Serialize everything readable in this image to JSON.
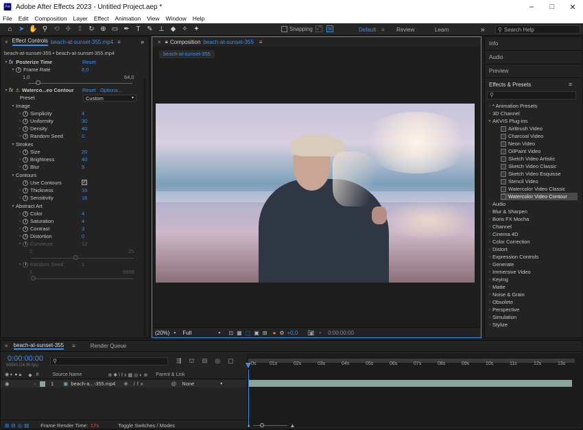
{
  "app": {
    "title": "Adobe After Effects 2023 - Untitled Project.aep *",
    "logo": "Ae"
  },
  "menu": [
    "File",
    "Edit",
    "Composition",
    "Layer",
    "Effect",
    "Animation",
    "View",
    "Window",
    "Help"
  ],
  "window_controls": {
    "minimize": "–",
    "maximize": "□",
    "close": "✕"
  },
  "toolbar": {
    "snapping_label": "Snapping",
    "workspaces": [
      "Default",
      "Review",
      "Learn"
    ],
    "search_placeholder": "Search Help",
    "more": "»"
  },
  "effect_controls": {
    "tab_label": "Effect Controls",
    "tab_file": "beach-at-sunset-355.mp4",
    "breadcrumb": "beach-at-sunset-355 • beach-at-sunset-355.mp4",
    "posterize": {
      "name": "Posterize Time",
      "reset": "Reset",
      "frame_rate_label": "Frame Rate",
      "frame_rate": "8,0",
      "range_min": "1,0",
      "range_max": "64,0"
    },
    "watercolor": {
      "name": "Waterco...eo Contour",
      "reset": "Reset",
      "options": "Options...",
      "preset_label": "Preset",
      "preset_value": "Custom",
      "groups": [
        {
          "name": "Image",
          "params": [
            {
              "label": "Simplicity",
              "value": "4"
            },
            {
              "label": "Uniformity",
              "value": "30"
            },
            {
              "label": "Density",
              "value": "40"
            },
            {
              "label": "Random Seed",
              "value": "0"
            }
          ]
        },
        {
          "name": "Strokes",
          "params": [
            {
              "label": "Size",
              "value": "20"
            },
            {
              "label": "Brightness",
              "value": "40"
            },
            {
              "label": "Blur",
              "value": "5"
            }
          ]
        },
        {
          "name": "Contours",
          "params": [
            {
              "label": "Use Contours",
              "value": "checked"
            },
            {
              "label": "Thickness",
              "value": "16"
            },
            {
              "label": "Sensitivity",
              "value": "16"
            }
          ]
        },
        {
          "name": "Abstract Art",
          "params": [
            {
              "label": "Color",
              "value": "4"
            },
            {
              "label": "Saturation",
              "value": "4"
            },
            {
              "label": "Contrast",
              "value": "3"
            },
            {
              "label": "Distortion",
              "value": "0"
            }
          ]
        }
      ],
      "curvature": {
        "label": "Curvature",
        "value": "12",
        "min": "2",
        "max": "25"
      },
      "random_seed2": {
        "label": "Random Seed",
        "value": "1",
        "min": "1",
        "max": "9999"
      }
    }
  },
  "composition": {
    "tab_label": "Composition",
    "tab_name": "beach-at-sunset-355",
    "subtab": "beach-at-sunset-355",
    "zoom": "(20%)",
    "resolution": "Full",
    "exposure": "+0,0",
    "timecode": "0:00:00:00"
  },
  "right_panels": {
    "info": "Info",
    "audio": "Audio",
    "preview": "Preview",
    "effects_presets": "Effects & Presets",
    "categories_top": [
      "* Animation Presets",
      "3D Channel"
    ],
    "akvis": {
      "name": "AKVIS Plug-ins",
      "items": [
        "AirBrush Video",
        "Charcoal Video",
        "Neon Video",
        "OilPaint Video",
        "Sketch Video Artistic",
        "Sketch Video Classic",
        "Sketch Video Esquisse",
        "Stencil Video",
        "Watercolor Video Classic",
        "Watercolor Video Contour"
      ],
      "selected": "Watercolor Video Contour"
    },
    "categories": [
      "Audio",
      "Blur & Sharpen",
      "Boris FX Mocha",
      "Channel",
      "Cinema 4D",
      "Color Correction",
      "Distort",
      "Expression Controls",
      "Generate",
      "Immersive Video",
      "Keying",
      "Matte",
      "Noise & Grain",
      "Obsolete",
      "Perspective",
      "Simulation",
      "Stylize"
    ]
  },
  "timeline": {
    "tab_label": "beach-at-sunset-355",
    "render_queue": "Render Queue",
    "timecode": "0:00:00:00",
    "fps": "00000 (24.00 fps)",
    "columns": {
      "num": "#",
      "source": "Source Name",
      "parent": "Parent & Link"
    },
    "layer": {
      "num": "1",
      "name": "beach-a...-355.mp4",
      "parent": "None"
    },
    "ruler": [
      "0s",
      "01s",
      "02s",
      "03s",
      "04s",
      "05s",
      "06s",
      "07s",
      "08s",
      "09s",
      "10s",
      "11s",
      "12s",
      "13s"
    ],
    "footer": {
      "render_label": "Frame Render Time:",
      "render_time": "17s",
      "toggle": "Toggle Switches / Modes"
    }
  },
  "colors": {
    "accent": "#3f8fe8",
    "bg": "#1d1d1d",
    "panel": "#232323",
    "track": "#8aa59f",
    "render_time": "#e05050"
  }
}
